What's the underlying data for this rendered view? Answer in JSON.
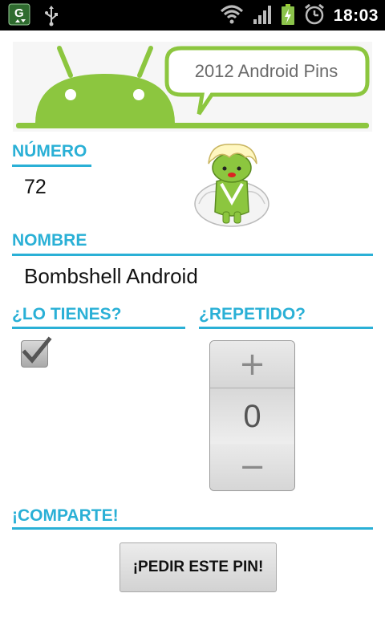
{
  "status_bar": {
    "time": "18:03",
    "icons": [
      "app-notification-icon",
      "usb-icon",
      "wifi-icon",
      "signal-icon",
      "battery-charging-icon",
      "alarm-icon"
    ]
  },
  "banner": {
    "text": "2012 Android Pins"
  },
  "numero": {
    "label": "NÚMERO",
    "value": "72"
  },
  "nombre": {
    "label": "NOMBRE",
    "value": "Bombshell Android"
  },
  "lo_tienes": {
    "label": "¿LO TIENES?",
    "checked": true
  },
  "repetido": {
    "label": "¿REPETIDO?",
    "value": "0",
    "plus": "+",
    "minus": "−"
  },
  "comparte": {
    "label": "¡COMPARTE!",
    "button": "¡PEDIR ESTE PIN!"
  },
  "colors": {
    "accent": "#2ab0d6",
    "android_green": "#8cc63f"
  }
}
